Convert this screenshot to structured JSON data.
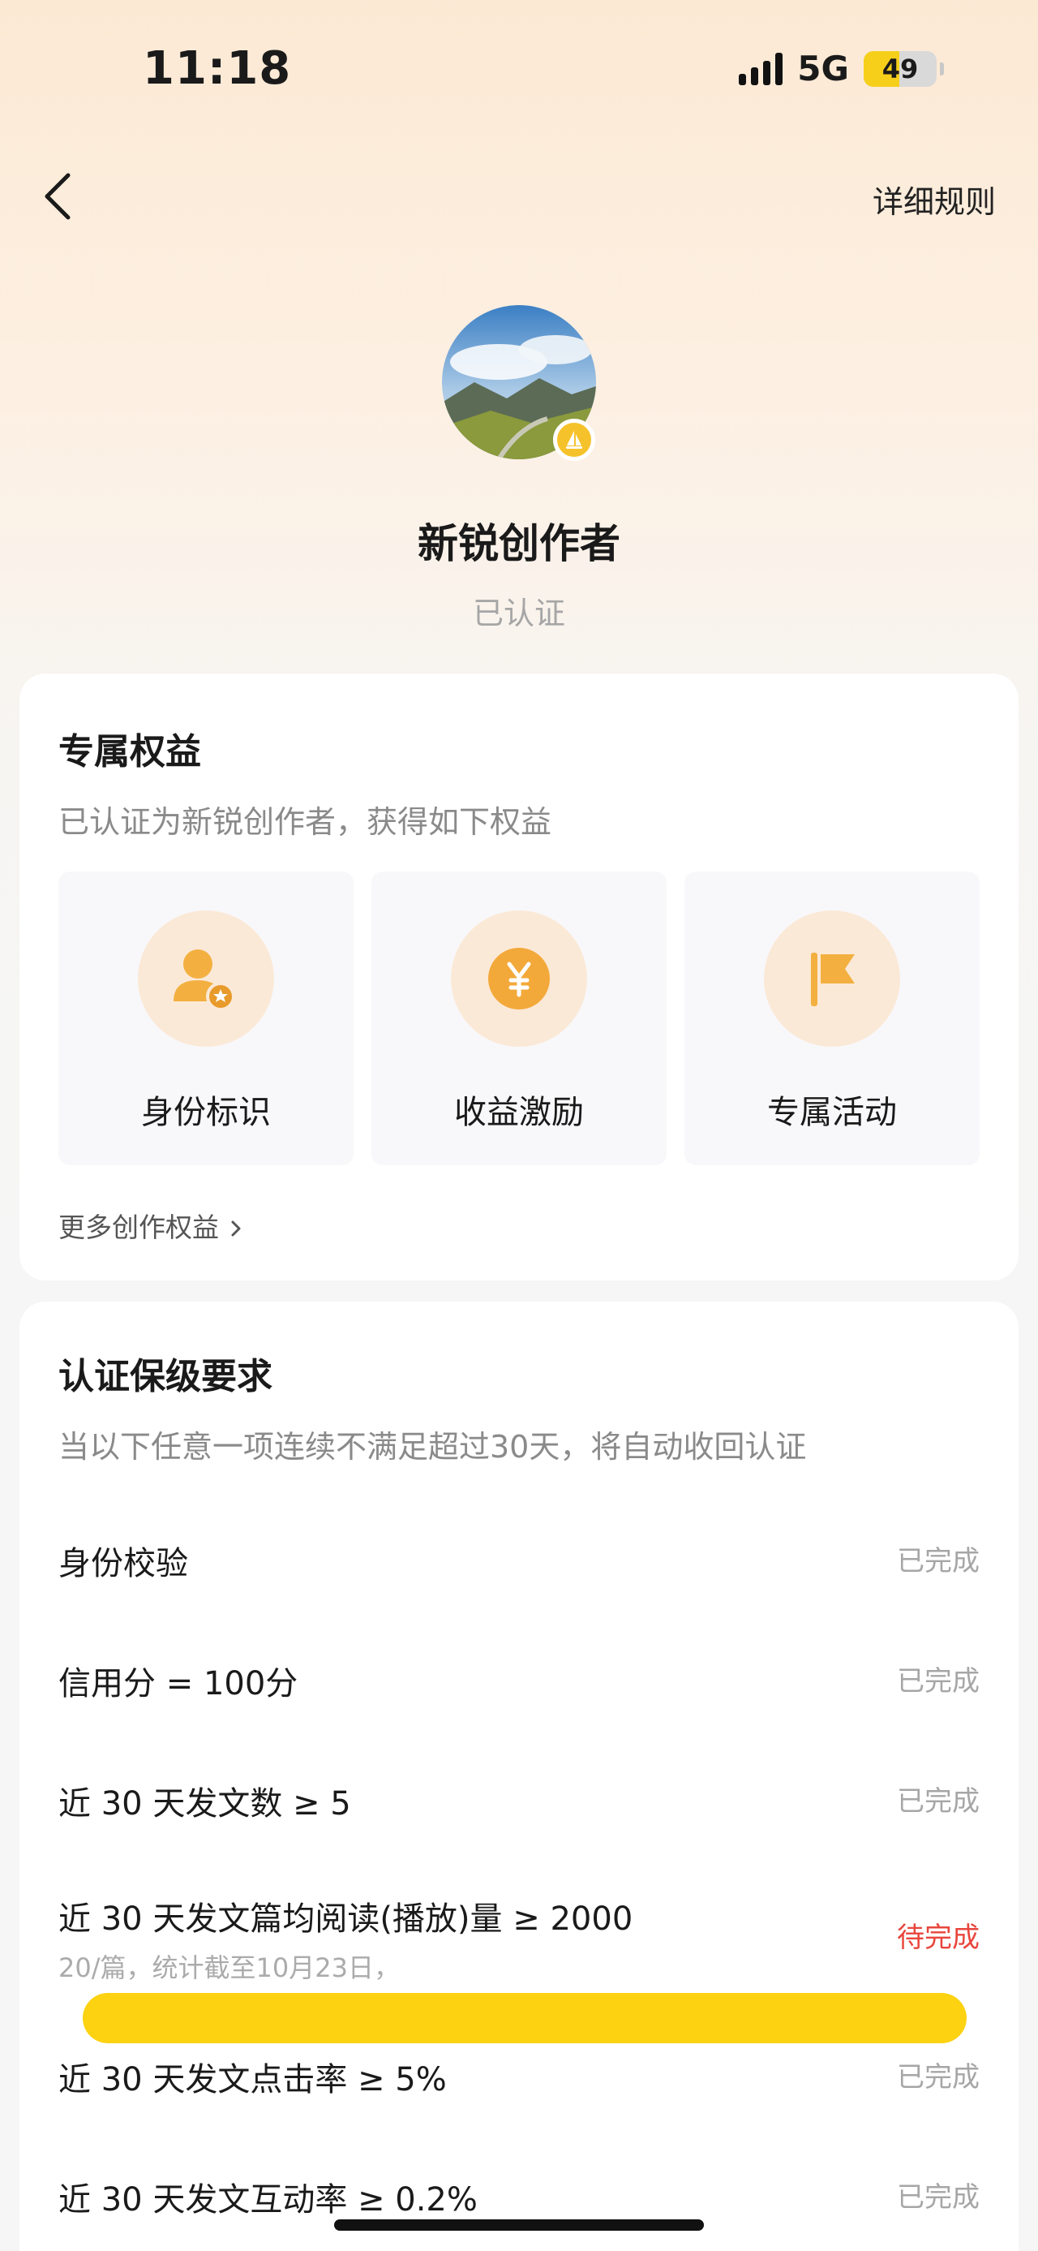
{
  "status_bar": {
    "time": "11:18",
    "network": "5G",
    "battery": "49"
  },
  "header": {
    "rules_label": "详细规则"
  },
  "profile": {
    "title": "新锐创作者",
    "subtitle": "已认证"
  },
  "benefits": {
    "title": "专属权益",
    "subtitle": "已认证为新锐创作者，获得如下权益",
    "items": [
      {
        "label": "身份标识",
        "icon": "user-badge-icon"
      },
      {
        "label": "收益激励",
        "icon": "yuan-coin-icon"
      },
      {
        "label": "专属活动",
        "icon": "flag-icon"
      }
    ],
    "more_label": "更多创作权益"
  },
  "requirements": {
    "title": "认证保级要求",
    "subtitle": "当以下任意一项连续不满足超过30天，将自动收回认证",
    "items": [
      {
        "label": "身份校验",
        "status": "已完成"
      },
      {
        "label": "信用分 = 100分",
        "status": "已完成"
      },
      {
        "label": "近 30 天发文数 ≥ 5",
        "status": "已完成"
      },
      {
        "label": "近 30 天发文篇均阅读(播放)量 ≥ 2000",
        "status": "待完成",
        "note": "20/篇，统计截至10月23日，"
      },
      {
        "label": "近 30 天发文点击率 ≥ 5%",
        "status": "已完成"
      },
      {
        "label": "近 30 天发文互动率 ≥ 0.2%",
        "status": "已完成"
      }
    ]
  },
  "colors": {
    "accent": "#f6a623",
    "pending": "#e8463c",
    "highlight": "#fcd211"
  }
}
